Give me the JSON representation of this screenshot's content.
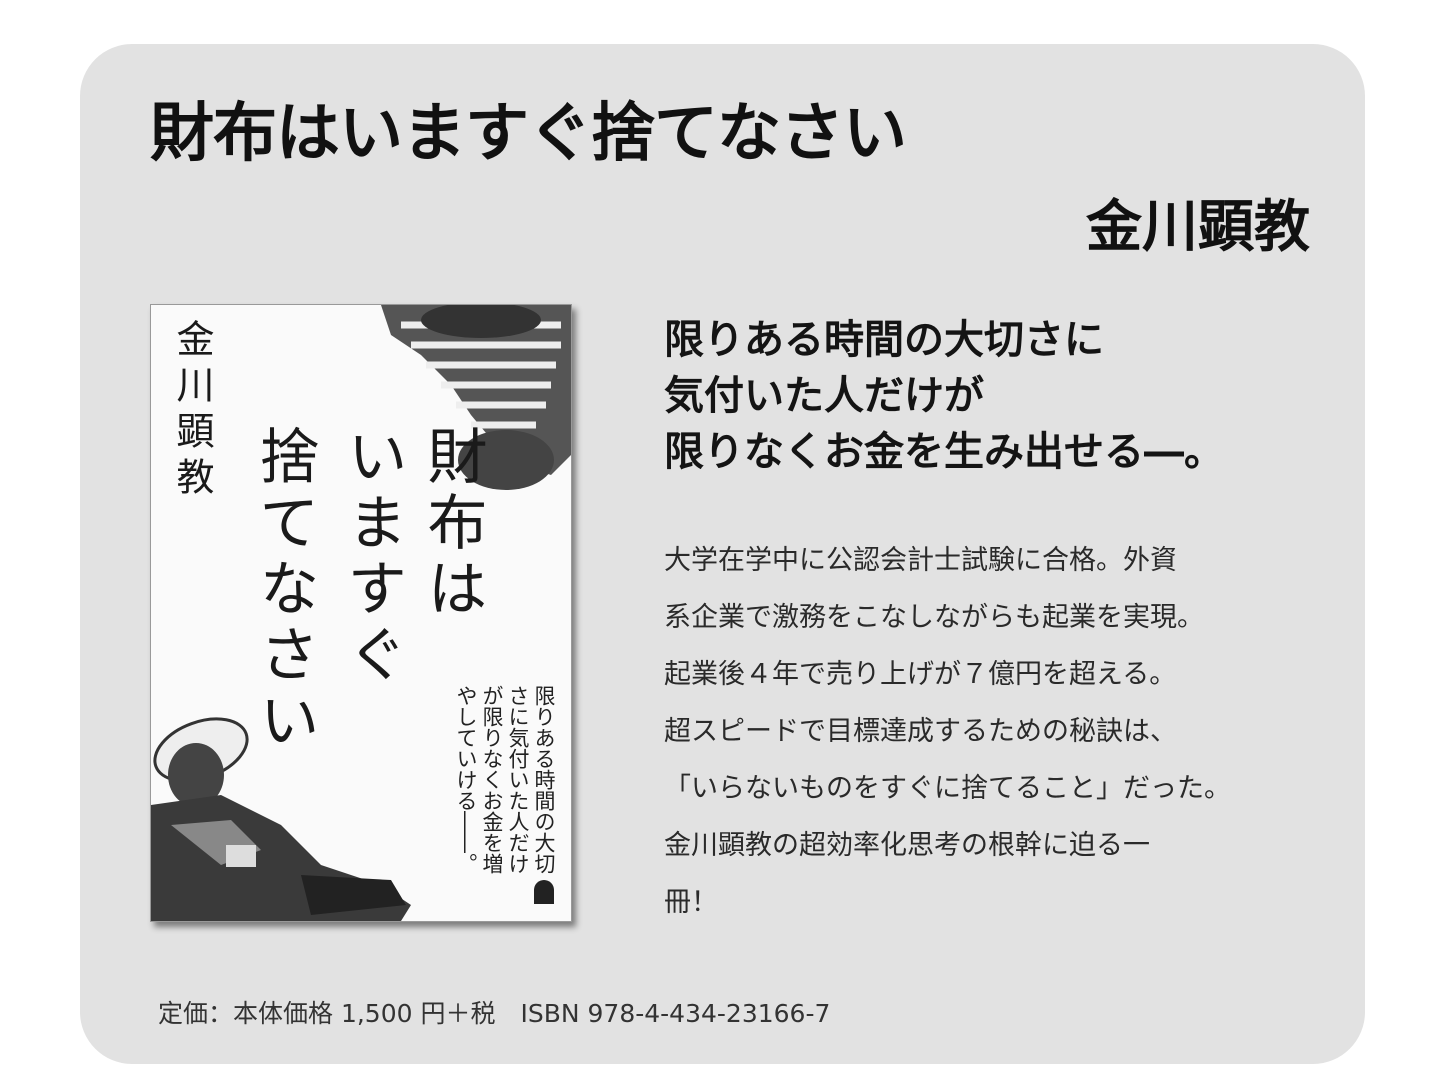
{
  "book": {
    "title": "財布はいますぐ捨てなさい",
    "author": "金川顕教"
  },
  "cover": {
    "author": "金川顕教",
    "title_lines": [
      "財布は",
      "いますぐ",
      "捨てなさい"
    ],
    "copy": "限りある時間の大切さに気付いた人だけが限りなくお金を増やしていける――。"
  },
  "headline": {
    "lines": [
      "限りある時間の大切さに",
      "気付いた人だけが",
      "限りなくお金を生み出せる―。"
    ]
  },
  "description": {
    "lines": [
      "大学在学中に公認会計士試験に合格。外資",
      "系企業で激務をこなしながらも起業を実現。",
      "起業後４年で売り上げが７億円を超える。",
      "超スピードで目標達成するための秘訣は、",
      "「いらないものをすぐに捨てること」だった。",
      "金川顕教の超効率化思考の根幹に迫る一",
      "冊！"
    ]
  },
  "footer": {
    "price_isbn": "定価：本体価格 1,500 円＋税　ISBN 978-4-434-23166-7"
  },
  "colors": {
    "card_background": "#e2e2e2",
    "text": "#111111"
  }
}
